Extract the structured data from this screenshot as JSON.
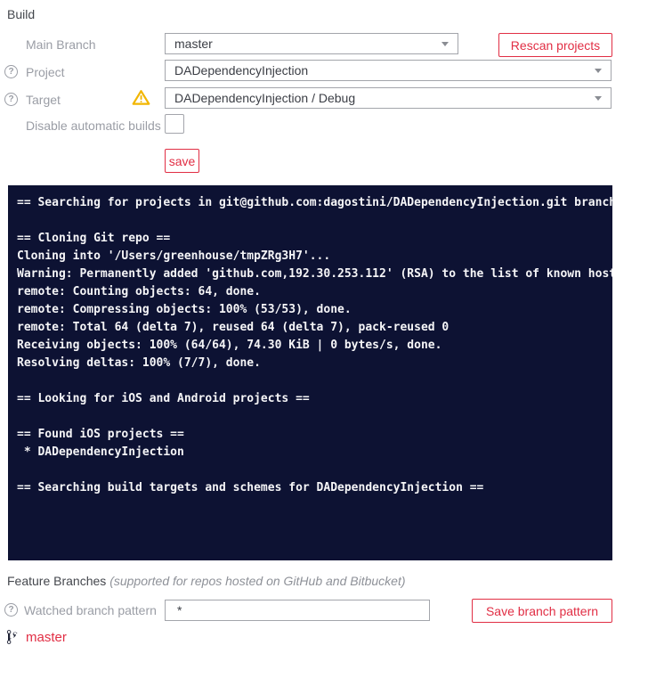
{
  "build": {
    "title": "Build",
    "main_branch": {
      "label": "Main Branch",
      "value": "master"
    },
    "project": {
      "label": "Project",
      "value": "DADependencyInjection"
    },
    "target": {
      "label": "Target",
      "value": "DADependencyInjection / Debug"
    },
    "disable_auto": {
      "label": "Disable automatic builds",
      "checked": false
    },
    "rescan_label": "Rescan projects",
    "save_label": "save",
    "help_glyph": "?"
  },
  "console": {
    "lines": [
      "== Searching for projects in git@github.com:dagostini/DADependencyInjection.git branch",
      "",
      "== Cloning Git repo ==",
      "Cloning into '/Users/greenhouse/tmpZRg3H7'...",
      "Warning: Permanently added 'github.com,192.30.253.112' (RSA) to the list of known host",
      "remote: Counting objects: 64, done.",
      "remote: Compressing objects: 100% (53/53), done.",
      "remote: Total 64 (delta 7), reused 64 (delta 7), pack-reused 0",
      "Receiving objects: 100% (64/64), 74.30 KiB | 0 bytes/s, done.",
      "Resolving deltas: 100% (7/7), done.",
      "",
      "== Looking for iOS and Android projects ==",
      "",
      "== Found iOS projects ==",
      " * DADependencyInjection",
      "",
      "== Searching build targets and schemes for DADependencyInjection =="
    ]
  },
  "feature_branches": {
    "title": "Feature Branches",
    "subtitle": "(supported for repos hosted on GitHub and Bitbucket)",
    "watched": {
      "label": "Watched branch pattern",
      "value": "*"
    },
    "save_label": "Save branch pattern",
    "branches": [
      {
        "name": "master"
      }
    ],
    "help_glyph": "?"
  },
  "colors": {
    "accent_red": "#e12e44",
    "warning_yellow": "#f2b600",
    "console_bg": "#0d1233",
    "console_fg": "#f5f5f7",
    "label_gray": "#9a9da5",
    "heading_gray": "#44474d",
    "border_gray": "#a3a5ab"
  }
}
